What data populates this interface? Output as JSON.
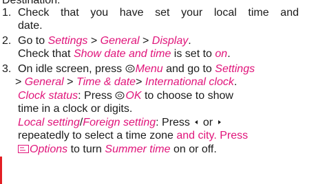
{
  "heading_cut": "Destination:",
  "steps": [
    {
      "num": "1.",
      "line1": "Check that you have set your local time and",
      "line2": "date."
    },
    {
      "num": "2.",
      "goto_prefix": "Go to ",
      "path": [
        "Settings",
        "General",
        "Display"
      ],
      "sep": " > ",
      "period": ".",
      "check_prefix": "Check that ",
      "check_item": "Show date and time",
      "check_mid": " is set to ",
      "check_value": "on",
      "check_end": "."
    },
    {
      "num": "3.",
      "idle_prefix": "On idle screen, press ",
      "menu_key": "Menu",
      "idle_mid": " and go to ",
      "settings": "Settings",
      "sep": " > ",
      "general": "General",
      "timedate": "Time & date",
      "sep2": "> ",
      "intl": "International clock",
      "period": ".",
      "clock_status": "Clock status",
      "clock_colon": ": Press ",
      "ok_key": "OK",
      "clock_rest_1": " to choose to show",
      "clock_rest_2": "time in a clock or digits.",
      "local_setting": "Local setting",
      "slash": "/",
      "foreign_setting": "Foreign setting",
      "ls_colon": ": Press ",
      "or": " or ",
      "repeat_text": "repeatedly to select a time zone ",
      "and_city": "and city. Press",
      "options_key": "Options",
      "turn": " to turn ",
      "summer_time": "Summer time",
      "onoff": " on or off."
    }
  ],
  "colors": {
    "accent": "#e0147a",
    "text": "#1a1a1a",
    "margin_bar": "#e31e24"
  },
  "icons": [
    "center-key-icon",
    "left-arrow-icon",
    "right-arrow-icon",
    "softkey-options-icon"
  ]
}
